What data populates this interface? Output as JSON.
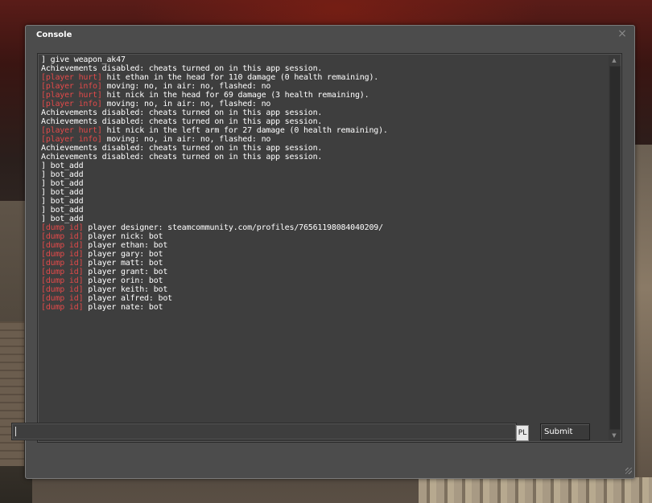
{
  "window": {
    "title": "Console",
    "close_glyph": "×"
  },
  "log": [
    {
      "tag": "",
      "text": "] give weapon_ak47"
    },
    {
      "tag": "",
      "text": "Achievements disabled: cheats turned on in this app session."
    },
    {
      "tag": "[player hurt]",
      "text": " hit ethan in the head for 110 damage (0 health remaining)."
    },
    {
      "tag": "[player info]",
      "text": " moving: no, in air: no, flashed: no"
    },
    {
      "tag": "[player hurt]",
      "text": " hit nick in the head for 69 damage (3 health remaining)."
    },
    {
      "tag": "[player info]",
      "text": " moving: no, in air: no, flashed: no"
    },
    {
      "tag": "",
      "text": "Achievements disabled: cheats turned on in this app session."
    },
    {
      "tag": "",
      "text": "Achievements disabled: cheats turned on in this app session."
    },
    {
      "tag": "[player hurt]",
      "text": " hit nick in the left arm for 27 damage (0 health remaining)."
    },
    {
      "tag": "[player info]",
      "text": " moving: no, in air: no, flashed: no"
    },
    {
      "tag": "",
      "text": "Achievements disabled: cheats turned on in this app session."
    },
    {
      "tag": "",
      "text": "Achievements disabled: cheats turned on in this app session."
    },
    {
      "tag": "",
      "text": "] bot_add"
    },
    {
      "tag": "",
      "text": "] bot_add"
    },
    {
      "tag": "",
      "text": "] bot_add"
    },
    {
      "tag": "",
      "text": "] bot_add"
    },
    {
      "tag": "",
      "text": "] bot_add"
    },
    {
      "tag": "",
      "text": "] bot_add"
    },
    {
      "tag": "",
      "text": "] bot_add"
    },
    {
      "tag": "[dump id]",
      "text": " player designer: steamcommunity.com/profiles/76561198084040209/"
    },
    {
      "tag": "[dump id]",
      "text": " player nick: bot"
    },
    {
      "tag": "[dump id]",
      "text": " player ethan: bot"
    },
    {
      "tag": "[dump id]",
      "text": " player gary: bot"
    },
    {
      "tag": "[dump id]",
      "text": " player matt: bot"
    },
    {
      "tag": "[dump id]",
      "text": " player grant: bot"
    },
    {
      "tag": "[dump id]",
      "text": " player orin: bot"
    },
    {
      "tag": "[dump id]",
      "text": " player keith: bot"
    },
    {
      "tag": "[dump id]",
      "text": " player alfred: bot"
    },
    {
      "tag": "[dump id]",
      "text": " player nate: bot"
    }
  ],
  "input": {
    "value": "",
    "language_indicator": "PL"
  },
  "submit_label": "Submit",
  "scroll": {
    "up_glyph": "▲",
    "down_glyph": "▼"
  },
  "colors": {
    "tag": "#e24a4a",
    "text": "#ffffff",
    "panel": "#3e3e3e",
    "window": "#4c4c4c"
  }
}
